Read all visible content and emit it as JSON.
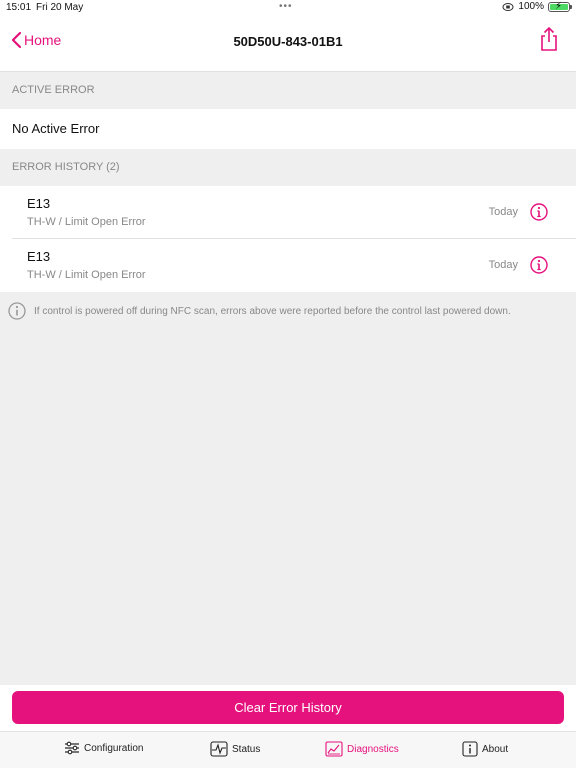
{
  "status_bar": {
    "time": "15:01",
    "date": "Fri 20 May",
    "dots": "•••",
    "battery": "100%"
  },
  "nav": {
    "back_label": "Home",
    "title": "50D50U-843-01B1"
  },
  "active_error": {
    "header": "ACTIVE ERROR",
    "value": "No Active Error"
  },
  "error_history": {
    "header": "ERROR HISTORY (2)",
    "items": [
      {
        "code": "E13",
        "description": "TH-W / Limit Open Error",
        "when": "Today"
      },
      {
        "code": "E13",
        "description": "TH-W / Limit Open Error",
        "when": "Today"
      }
    ]
  },
  "note": "If control is powered off during NFC scan, errors above were reported before the control last powered down.",
  "clear_button": "Clear Error History",
  "tabs": [
    {
      "label": "Configuration",
      "icon": "sliders-icon"
    },
    {
      "label": "Status",
      "icon": "pulse-icon"
    },
    {
      "label": "Diagnostics",
      "icon": "chart-icon"
    },
    {
      "label": "About",
      "icon": "info-icon"
    }
  ],
  "colors": {
    "accent": "#e5127d",
    "background": "#efeff0",
    "secondary_text": "#888888"
  }
}
